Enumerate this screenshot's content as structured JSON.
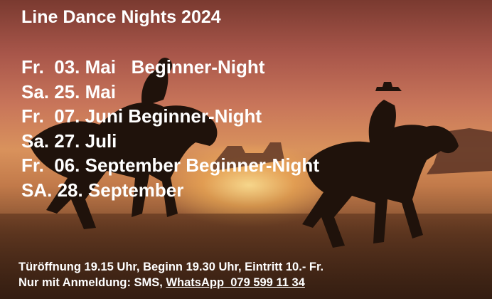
{
  "title": "Line Dance Nights 2024",
  "dates": [
    "Fr.  03. Mai   Beginner-Night",
    "Sa. 25. Mai",
    "Fr.  07. Juni Beginner-Night",
    "Sa. 27. Juli",
    "Fr.  06. September Beginner-Night",
    "SA. 28. September"
  ],
  "info": {
    "line1": "Türöffnung 19.15 Uhr, Beginn 19.30 Uhr, Eintritt 10.- Fr.",
    "line2_prefix": "Nur mit Anmeldung: SMS, ",
    "whatsapp": "WhatsApp  079 599 11 34"
  }
}
